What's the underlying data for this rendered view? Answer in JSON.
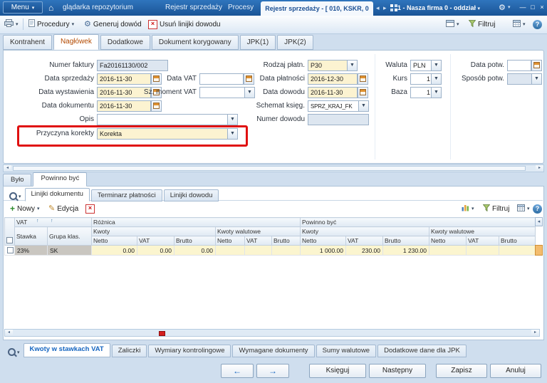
{
  "titlebar": {
    "menu_label": "Menu",
    "nav_tabs": [
      "glądarka repozytorium",
      "Rejestr sprzedaży",
      "Procesy"
    ],
    "active_doc_tab": "Rejestr sprzedaży - [ 010, KSKR, 0",
    "company_selector": "1 - Nasza firma 0 - oddział"
  },
  "toolbar": {
    "procedures_label": "Procedury",
    "generate_label": "Generuj dowód",
    "delete_lines_label": "Usuń linijki dowodu",
    "filter_label": "Filtruj"
  },
  "form_tabs": {
    "items": [
      "Kontrahent",
      "Nagłówek",
      "Dodatkowe",
      "Dokument korygowany",
      "JPK(1)",
      "JPK(2)"
    ]
  },
  "form": {
    "numer_faktury": {
      "label": "Numer faktury",
      "value": "Fa20161130/002"
    },
    "data_sprzedazy": {
      "label": "Data sprzedaży",
      "value": "2016-11-30"
    },
    "data_wystawienia": {
      "label": "Data wystawienia",
      "value": "2016-11-30"
    },
    "data_dokumentu": {
      "label": "Data dokumentu",
      "value": "2016-11-30"
    },
    "opis": {
      "label": "Opis",
      "value": ""
    },
    "przyczyna_korekty": {
      "label": "Przyczyna korekty",
      "value": "Korekta"
    },
    "data_vat": {
      "label": "Data VAT",
      "value": ""
    },
    "sz_moment_vat": {
      "label": "Sz. moment VAT",
      "value": ""
    },
    "rodzaj_platn": {
      "label": "Rodzaj płatn.",
      "value": "P30"
    },
    "data_platnosci": {
      "label": "Data płatności",
      "value": "2016-12-30"
    },
    "data_dowodu": {
      "label": "Data dowodu",
      "value": "2016-11-30"
    },
    "schemat_ksieg": {
      "label": "Schemat księg.",
      "value": "SPRZ_KRAJ_FK"
    },
    "numer_dowodu": {
      "label": "Numer dowodu",
      "value": ""
    },
    "waluta": {
      "label": "Waluta",
      "value": "PLN"
    },
    "kurs": {
      "label": "Kurs",
      "value": "1"
    },
    "baza": {
      "label": "Baza",
      "value": "1"
    },
    "data_potw": {
      "label": "Data potw.",
      "value": ""
    },
    "sposob_potw": {
      "label": "Sposób potw.",
      "value": ""
    }
  },
  "mid_tabs": {
    "items": [
      "Było",
      "Powinno być"
    ]
  },
  "detail_tabs": {
    "items": [
      "Linijki dokumentu",
      "Terminarz płatności",
      "Linijki dowodu"
    ]
  },
  "grid_toolbar": {
    "new_label": "Nowy",
    "edit_label": "Edycja",
    "filter_label": "Filtruj"
  },
  "grid": {
    "groups": {
      "vat": "VAT",
      "roznica": "Różnica",
      "powinno": "Powinno być"
    },
    "subheaders": {
      "stawka": "Stawka",
      "grupa": "Grupa klas.",
      "kwoty": "Kwoty",
      "kwoty_walutowe": "Kwoty walutowe"
    },
    "cols": {
      "netto": "Netto",
      "vat": "VAT",
      "brutto": "Brutto"
    },
    "rows": [
      {
        "stawka": "23%",
        "grupa": "SK",
        "r_netto": "0.00",
        "r_vat": "0.00",
        "r_brutto": "0.00",
        "p_netto": "1 000.00",
        "p_vat": "230.00",
        "p_brutto": "1 230.00"
      }
    ]
  },
  "bottom_tabs": {
    "items": [
      "Kwoty w stawkach VAT",
      "Zaliczki",
      "Wymiary kontrolingowe",
      "Wymagane dokumenty",
      "Sumy walutowe",
      "Dodatkowe dane dla JPK"
    ]
  },
  "footer": {
    "ksieguj": "Księguj",
    "nastepny": "Następny",
    "zapisz": "Zapisz",
    "anuluj": "Anuluj"
  }
}
